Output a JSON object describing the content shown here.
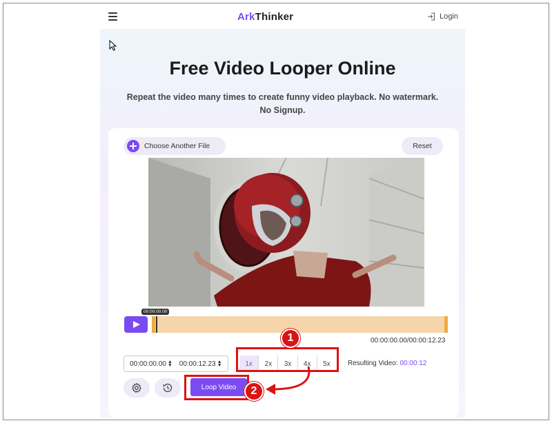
{
  "header": {
    "logo_accent": "Ark",
    "logo_rest": "Thinker",
    "login_label": "Login"
  },
  "hero": {
    "title": "Free Video Looper Online",
    "subtitle": "Repeat the video many times to create funny video playback. No watermark. No Signup."
  },
  "tool": {
    "choose_file_label": "Choose Another File",
    "reset_label": "Reset",
    "timeline_badge": "00:00:00.00",
    "timeline_time": "00:00:00.00/00:00:12.23",
    "start_time": "00:00:00.00",
    "end_time": "00:00:12.23",
    "speeds": [
      "1x",
      "2x",
      "3x",
      "4x",
      "5x"
    ],
    "selected_speed": "1x",
    "result_label": "Resulting Video:",
    "result_value": "00:00:12",
    "loop_button_label": "Loop Video"
  },
  "annotations": {
    "step1": "1",
    "step2": "2"
  },
  "colors": {
    "accent": "#7b4bf2",
    "timeline": "#f5d5a9",
    "timeline_handle": "#f0ac3c",
    "annotation_red": "#e01010"
  },
  "icons": [
    "menu-icon",
    "login-icon",
    "plus-icon",
    "play-icon",
    "settings-icon",
    "history-icon",
    "mouse-cursor-icon"
  ]
}
